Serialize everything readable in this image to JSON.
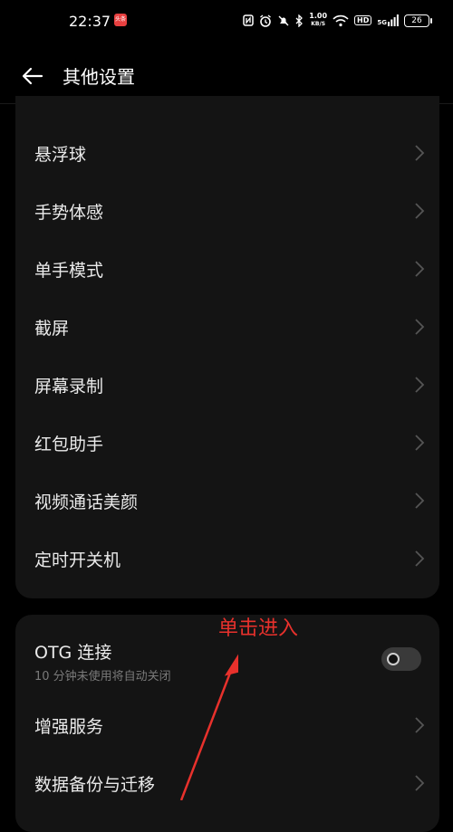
{
  "status_bar": {
    "time": "22:37",
    "app_icon_text": "头条",
    "speed_value": "1.00",
    "speed_unit": "KB/S",
    "hd": "HD",
    "signal_label": "5G",
    "battery": "26"
  },
  "header": {
    "title": "其他设置"
  },
  "card1": {
    "items": [
      {
        "label": "悬浮球"
      },
      {
        "label": "手势体感"
      },
      {
        "label": "单手模式"
      },
      {
        "label": "截屏"
      },
      {
        "label": "屏幕录制"
      },
      {
        "label": "红包助手"
      },
      {
        "label": "视频通话美颜"
      },
      {
        "label": "定时开关机"
      }
    ]
  },
  "card2": {
    "otg": {
      "label": "OTG 连接",
      "description": "10 分钟未使用将自动关闭",
      "enabled": false
    },
    "items": [
      {
        "label": "增强服务"
      },
      {
        "label": "数据备份与迁移"
      }
    ]
  },
  "annotation": {
    "text": "单击进入",
    "color": "#e8312c"
  }
}
